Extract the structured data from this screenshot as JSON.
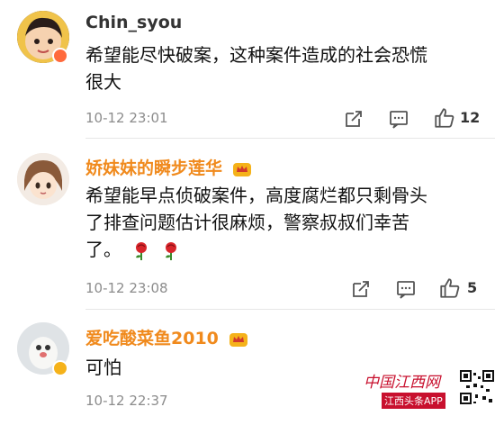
{
  "comments": [
    {
      "username": "Chin_syou",
      "text_line1": "希望能尽快破案，这种案件造成的社会恐慌",
      "text_line2": "很大",
      "time": "10-12 23:01",
      "likes": "12"
    },
    {
      "username": "娇妹妹的瞬步莲华",
      "text_line1": "希望能早点侦破案件，高度腐烂都只剩骨头",
      "text_line2": "了排查问题估计很麻烦，警察叔叔们幸苦",
      "text_line3": "了。",
      "time": "10-12 23:08",
      "likes": "5"
    },
    {
      "username": "爱吃酸菜鱼2010",
      "text_line1": "可怕",
      "time": "10-12 22:37"
    }
  ],
  "watermark": {
    "site": "中国江西网",
    "app": "江西头条APP"
  },
  "colors": {
    "vip_name": "#f08a1d",
    "divider": "#e6e6e6",
    "timestamp": "#8c8c8c"
  }
}
